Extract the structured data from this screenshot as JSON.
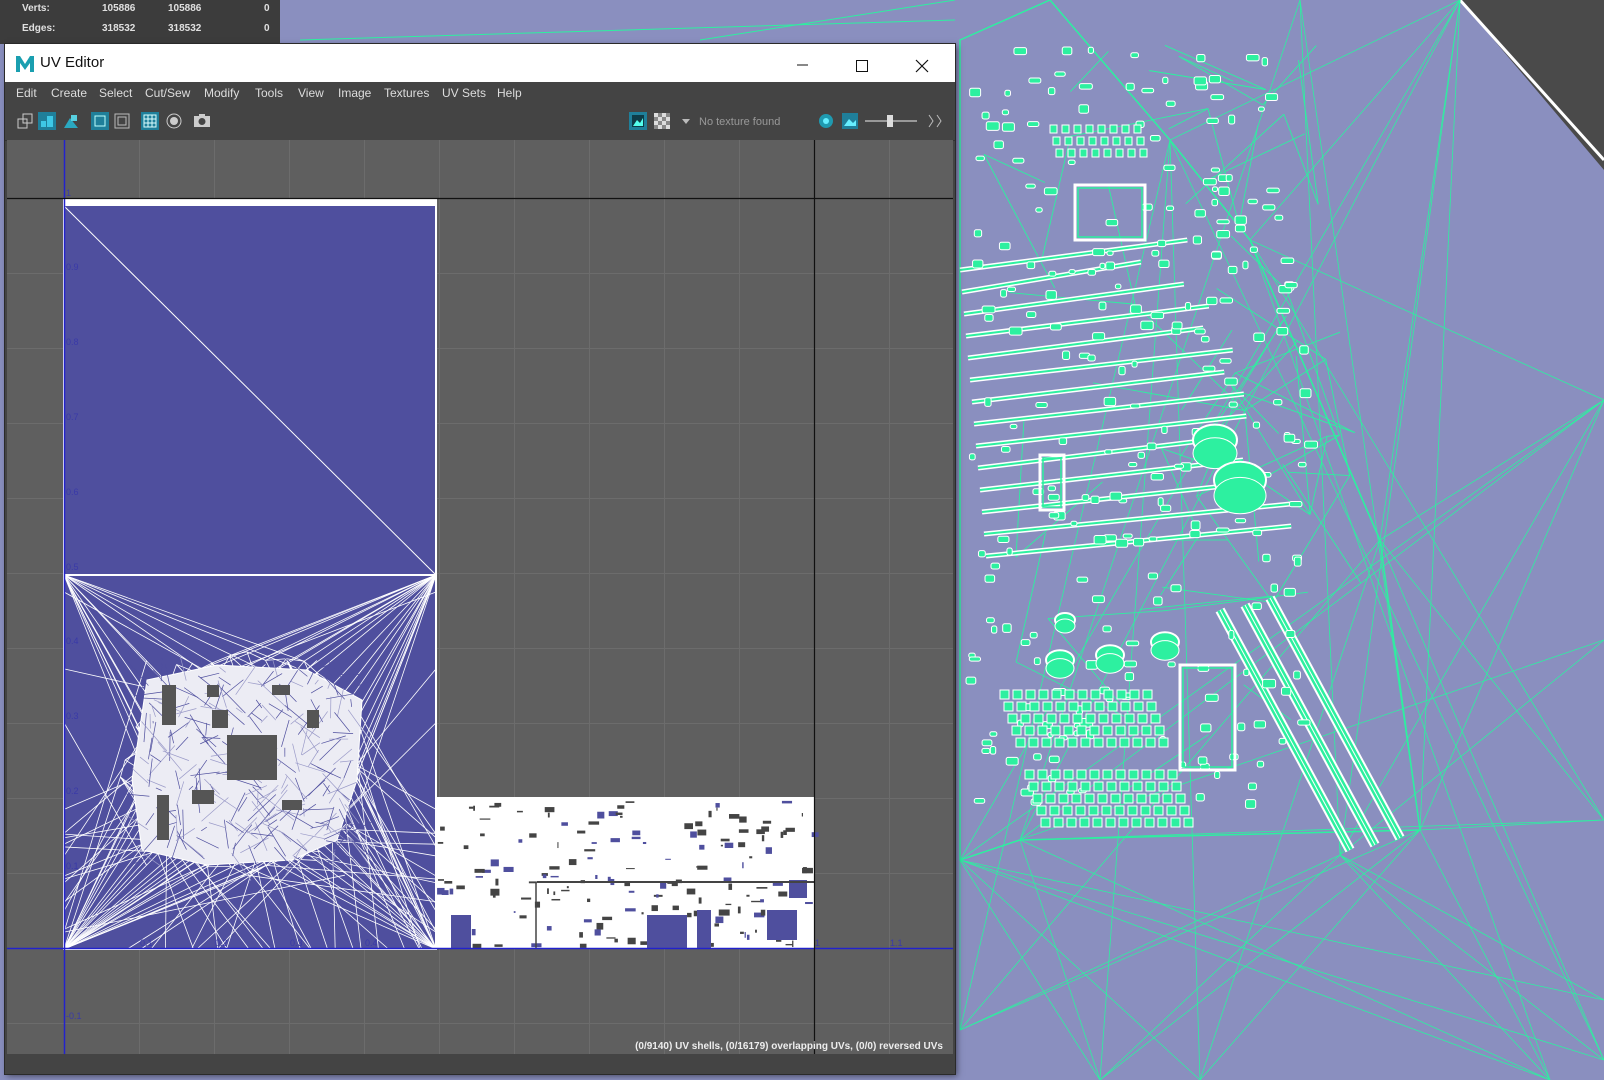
{
  "hud": {
    "rows": [
      {
        "label": "Verts:",
        "v1": "105886",
        "v2": "105886",
        "v3": "0"
      },
      {
        "label": "Edges:",
        "v1": "318532",
        "v2": "318532",
        "v3": "0"
      }
    ]
  },
  "window": {
    "title": "UV Editor",
    "logo_letter": "M",
    "menu": [
      "Edit",
      "Create",
      "Select",
      "Cut/Sew",
      "Modify",
      "Tools",
      "View",
      "Image",
      "Textures",
      "UV Sets",
      "Help"
    ],
    "texture_status": "No texture found",
    "status_text": "(0/9140) UV shells, (0/16179) overlapping UVs, (0/0) reversed UVs"
  },
  "uv_grid": {
    "v_labels": [
      "1",
      "0.9",
      "0.8",
      "0.7",
      "0.6",
      "0.5",
      "0.4",
      "0.3",
      "0.2",
      "0.1",
      "-0.1"
    ],
    "u_labels": [
      "0.1",
      "0.2",
      "0.3",
      "0.4",
      "1",
      "1.1"
    ]
  },
  "colors": {
    "viewport_bg": "#8a8fbf",
    "wire": "#2df0a0",
    "uv_fill": "#4f4f9e",
    "uv_canvas": "#5f5f5f",
    "axis": "#2222cc"
  },
  "icons": [
    "grid-view-icon",
    "uv-layout-icon",
    "shaded-uv-icon",
    "frame-icon",
    "frame-all-icon",
    "grid-toggle-icon",
    "isolate-icon",
    "snapshot-icon",
    "display-image-icon",
    "checker-icon",
    "dropdown-arrow-icon",
    "exposure-icon",
    "image-icon",
    "slider-icon",
    "collapse-icon"
  ]
}
